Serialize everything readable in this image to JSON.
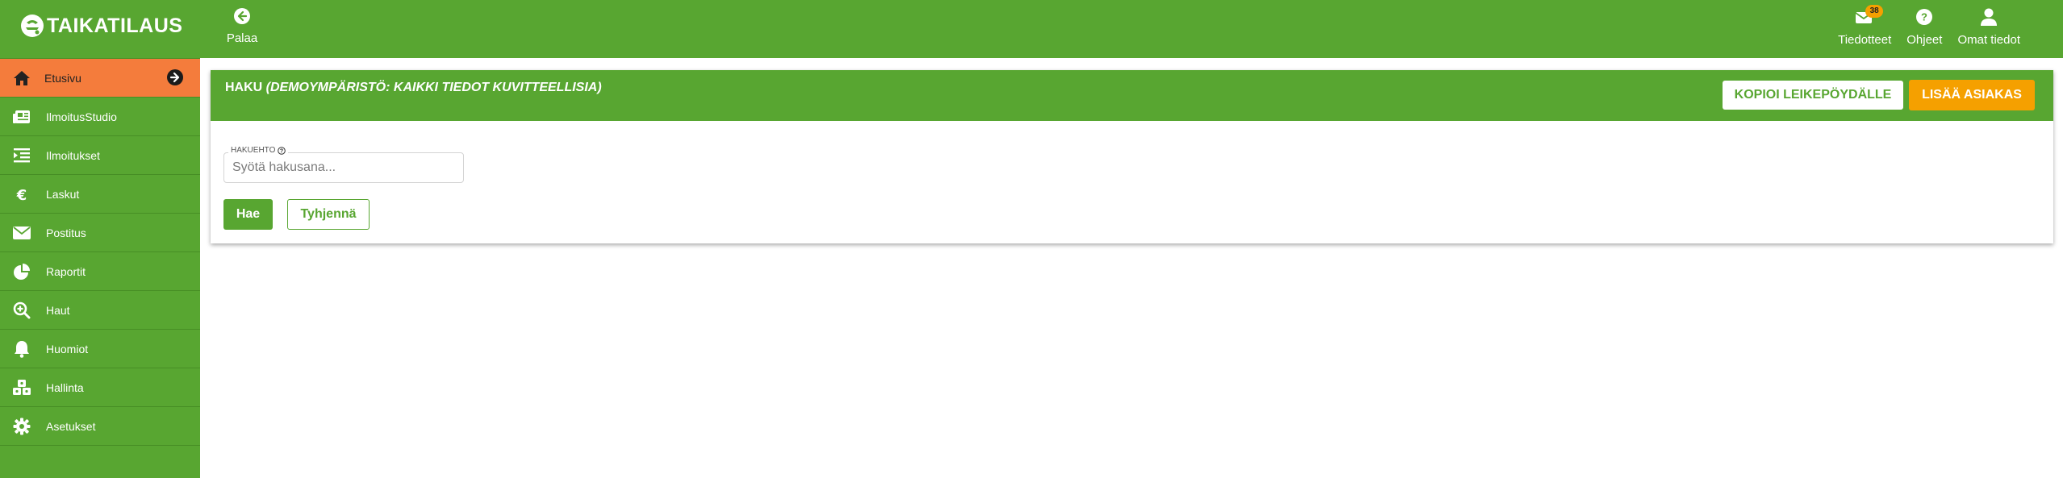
{
  "brand": {
    "name": "TAIKATILAUS"
  },
  "topbar": {
    "back_label": "Palaa",
    "items": [
      {
        "label": "Tiedotteet",
        "icon": "mail-icon",
        "badge": "38"
      },
      {
        "label": "Ohjeet",
        "icon": "help-icon"
      },
      {
        "label": "Omat tiedot",
        "icon": "user-icon"
      }
    ]
  },
  "sidebar": {
    "items": [
      {
        "label": "Etusivu",
        "icon": "home-icon",
        "active": true
      },
      {
        "label": "IlmoitusStudio",
        "icon": "newspaper-icon"
      },
      {
        "label": "Ilmoitukset",
        "icon": "list-indent-icon"
      },
      {
        "label": "Laskut",
        "icon": "euro-icon"
      },
      {
        "label": "Postitus",
        "icon": "envelope-icon"
      },
      {
        "label": "Raportit",
        "icon": "pie-chart-icon"
      },
      {
        "label": "Haut",
        "icon": "search-plus-icon"
      },
      {
        "label": "Huomiot",
        "icon": "bell-icon"
      },
      {
        "label": "Hallinta",
        "icon": "cubes-icon"
      },
      {
        "label": "Asetukset",
        "icon": "gear-icon"
      }
    ]
  },
  "panel": {
    "title": "HAKU",
    "title_note": "(DEMOYMPÄRISTÖ: KAIKKI TIEDOT KUVITTEELLISIA)",
    "copy_button": "KOPIOI LEIKEPÖYDÄLLE",
    "add_button": "LISÄÄ ASIAKAS",
    "search": {
      "label": "HAKUEHTO",
      "placeholder": "Syötä hakusana...",
      "value": ""
    },
    "search_button": "Hae",
    "clear_button": "Tyhjennä"
  },
  "colors": {
    "brand_green": "#58a631",
    "active_orange": "#f47c3c",
    "accent_orange": "#f5a000"
  }
}
